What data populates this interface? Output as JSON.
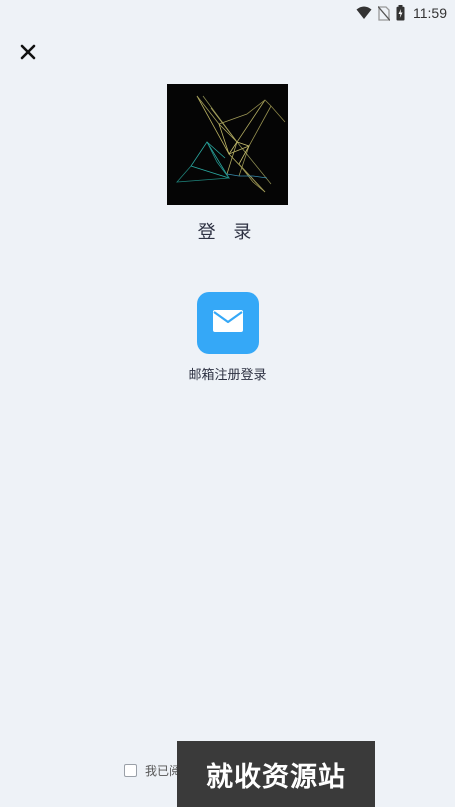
{
  "status_bar": {
    "time": "11:59",
    "icons": [
      "wifi-icon",
      "no-sim-icon",
      "battery-icon"
    ]
  },
  "header": {
    "close_icon": "close-icon"
  },
  "logo": {
    "icon": "app-logo"
  },
  "title": "登 录",
  "login_options": [
    {
      "label": "邮箱注册登录",
      "icon": "mail-icon",
      "color": "#35a8f7"
    }
  ],
  "agreement": {
    "text": "我已阅"
  },
  "watermark": {
    "text": "就收资源站"
  },
  "colors": {
    "background": "#eef2f7",
    "accent": "#35a8f7",
    "text": "#2d3142"
  }
}
